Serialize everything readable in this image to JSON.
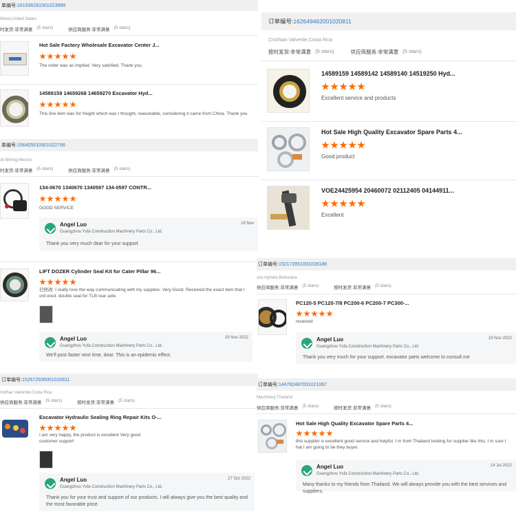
{
  "labels": {
    "order_no": "订单编号:",
    "stars": "(5 stars)"
  },
  "cards": [
    {
      "order_prefix": "单编号:",
      "order_number": "161936291501023989",
      "buyer": "Wood,United States",
      "rating_a_label": "时发货:",
      "rating_a_value": "非常满意",
      "rating_b_label": "供应商服务:",
      "rating_b_value": "非常满意",
      "items": [
        {
          "title": "Hot Sale Factory Wholesale Excavator Center J...",
          "comment": "The order was as implied.  Very satisfied.  Thank you."
        },
        {
          "title": "14589159 14659268 14659270 Excavator Hyd...",
          "comment": "This line item was for freight which was I thought, reasonable, considering it came from China.  Thank you"
        }
      ]
    },
    {
      "order_prefix": "单编号:",
      "order_number": "156405510501022766",
      "buyer": "ck Mining,Mexico",
      "rating_a_label": "时发货:",
      "rating_a_value": "非常满意",
      "rating_b_label": "供应商服务:",
      "rating_b_value": "非常满意",
      "items": [
        {
          "title": "134-0670 1340670 1340597 134-0597 CONTR...",
          "comment": "GOOD SERVICE",
          "reply": {
            "name": "Angel Luo",
            "company": "Guangzhou Yufa Construction Machinery Parts Co., Ltd.",
            "date": "19 Nov",
            "msg": "Thank you very much dear for your support"
          }
        },
        {
          "title": "LIFT DOZER Cylinder Seal Kit for Cater Pillar 96...",
          "comment": "已修改: I really love the way communicating with my supplies. Very Good. Received the exact item that I ord ered. double seal for TLB rear axle.",
          "reply": {
            "name": "Angel Luo",
            "company": "Guangzhou Yufa Construction Machinery Parts Co., Ltd.",
            "date": "19 Nov 2022",
            "msg": "We'll post faster next time, dear. This is an epidemic effect."
          }
        }
      ]
    },
    {
      "order_prefix": "订单编号:",
      "order_number": "152672935001020811",
      "buyer": "ristihan Valverde,Costa Rica",
      "rating_a_label": "供应商服务:",
      "rating_a_value": "非常满意",
      "rating_b_label": "按时发货:",
      "rating_b_value": "非常满意",
      "items": [
        {
          "title": "Excavator Hydraulic Sealing Ring Repair Kits O-...",
          "comment": "I am very happy, the product is excellent Very good customer support",
          "reply": {
            "name": "Angel Luo",
            "company": "Guangzhou Yufa Construction Machinery Parts Co., Ltd.",
            "date": "27 Oct 2022",
            "msg": "Thank you for your trust and support of our products. I will always give you the best quality and the most favorable price."
          }
        }
      ]
    },
    {
      "order_prefix": "订单编号:",
      "order_number": "162649462001020811",
      "buyer": "Cristhian Valverde,Costa Rica",
      "rating_a_label": "按时发货:",
      "rating_a_value": "非常满意",
      "rating_b_label": "供应商服务:",
      "rating_b_value": "非常满意",
      "items": [
        {
          "title": "14589159 14589142 14589140 14519250 Hyd...",
          "comment": "Excellent service and products"
        },
        {
          "title": "Hot Sale High Quality Excavator Spare Parts 4...",
          "comment": "Good product"
        },
        {
          "title": "VOE24425954 20460072 02112405 04144911...",
          "comment": "Excellent"
        }
      ]
    },
    {
      "order_prefix": "订单编号:",
      "order_number": "152173951001028188",
      "buyer": "ssa mphela,Botswana",
      "rating_a_label": "供应商服务:",
      "rating_a_value": "非常满意",
      "rating_b_label": "按时发货:",
      "rating_b_value": "非常满意",
      "items": [
        {
          "title": "PC120-5 PC120-7/8 PC200-6 PC200-7 PC300-...",
          "comment": "received",
          "reply": {
            "name": "Angel Luo",
            "company": "Guangzhou Yufa Construction Machinery Parts Co., Ltd.",
            "date": "19 Nov 2022",
            "msg": "Thank you very much for your support. excavator parts welcome to consult me"
          }
        }
      ]
    },
    {
      "order_prefix": "订单编号:",
      "order_number": "144782487001021067",
      "buyer": "Machinery,Thailand",
      "rating_a_label": "供应商服务:",
      "rating_a_value": "非常满意",
      "rating_b_label": "按时发货:",
      "rating_b_value": "非常满意",
      "items": [
        {
          "title": "Hot Sale High Quality Excavator Spare Parts 4...",
          "comment": "this supplier is excellent good service and helpful. I m from Thailand looking for supplier like this. I m sure t hat I am going to be they buyer.",
          "reply": {
            "name": "Angel Luo",
            "company": "Guangzhou Yufa Construction Machinery Parts Co., Ltd.",
            "date": "14 Jul 2022",
            "msg": "Many thanks to my friends from Thailand. We will always provide you with the best services and suppliers."
          }
        }
      ]
    }
  ]
}
